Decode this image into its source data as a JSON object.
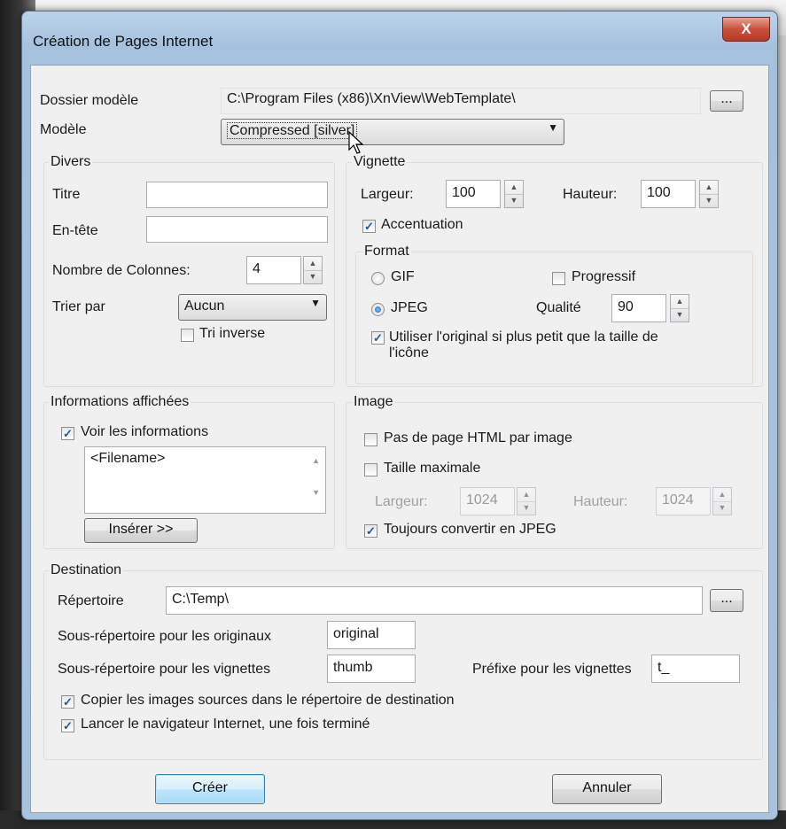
{
  "window": {
    "title": "Création de Pages Internet",
    "close_label": "X"
  },
  "top": {
    "dossier_label": "Dossier modèle",
    "dossier_value": "C:\\Program Files (x86)\\XnView\\WebTemplate\\",
    "browse_label": "...",
    "modele_label": "Modèle",
    "modele_value": "Compressed [silver]"
  },
  "divers": {
    "legend": "Divers",
    "titre_label": "Titre",
    "titre_value": "",
    "entete_label": "En-tête",
    "entete_value": "",
    "colonnes_label": "Nombre de Colonnes:",
    "colonnes_value": "4",
    "trier_label": "Trier par",
    "trier_value": "Aucun",
    "tri_inverse_label": "Tri inverse"
  },
  "vignette": {
    "legend": "Vignette",
    "largeur_label": "Largeur:",
    "largeur_value": "100",
    "hauteur_label": "Hauteur:",
    "hauteur_value": "100",
    "accentuation_label": "Accentuation",
    "format_legend": "Format",
    "gif_label": "GIF",
    "jpeg_label": "JPEG",
    "progressif_label": "Progressif",
    "qualite_label": "Qualité",
    "qualite_value": "90",
    "utiliser_line1": "Utiliser l'original si plus petit que la taille de",
    "utiliser_line2": "l'icône"
  },
  "infos": {
    "legend": "Informations affichées",
    "voir_label": "Voir les informations",
    "list_item": "<Filename>",
    "inserer_label": "Insérer >>"
  },
  "image": {
    "legend": "Image",
    "pas_page_label": "Pas de page HTML par image",
    "taille_max_label": "Taille maximale",
    "largeur_label": "Largeur:",
    "largeur_value": "1024",
    "hauteur_label": "Hauteur:",
    "hauteur_value": "1024",
    "convertir_label": "Toujours convertir en JPEG"
  },
  "destination": {
    "legend": "Destination",
    "repertoire_label": "Répertoire",
    "repertoire_value": "C:\\Temp\\",
    "browse_label": "...",
    "sous_orig_label": "Sous-répertoire pour les originaux",
    "sous_orig_value": "original",
    "sous_vign_label": "Sous-répertoire pour les vignettes",
    "sous_vign_value": "thumb",
    "prefixe_label": "Préfixe pour les vignettes",
    "prefixe_value": "t_",
    "copier_label": "Copier les images sources dans le répertoire de destination",
    "lancer_label": "Lancer le navigateur Internet, une fois terminé"
  },
  "buttons": {
    "creer": "Créer",
    "annuler": "Annuler"
  }
}
